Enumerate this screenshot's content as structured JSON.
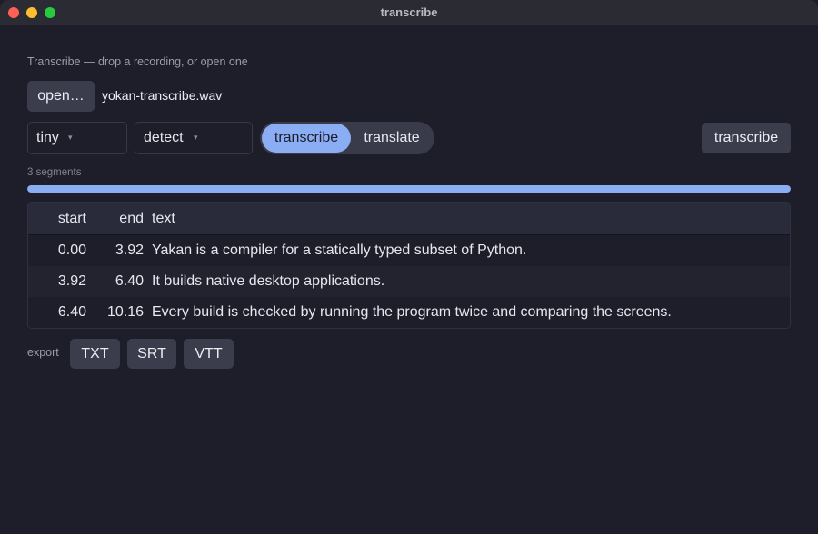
{
  "window": {
    "title": "transcribe"
  },
  "hint": "Transcribe — drop a recording, or open one",
  "file": {
    "open_label": "open…",
    "name": "yokan-transcribe.wav"
  },
  "options": {
    "model": "tiny",
    "language": "detect",
    "caret": "▾",
    "modes": [
      "transcribe",
      "translate"
    ],
    "selected_mode": "transcribe",
    "run_label": "transcribe"
  },
  "status": {
    "segments_label": "3 segments",
    "progress": 1.0
  },
  "table": {
    "headers": {
      "start": "start",
      "end": "end",
      "text": "text"
    },
    "rows": [
      {
        "start": "0.00",
        "end": "3.92",
        "text": "Yakan is a compiler for a statically typed subset of Python."
      },
      {
        "start": "3.92",
        "end": "6.40",
        "text": "It builds native desktop applications."
      },
      {
        "start": "6.40",
        "end": "10.16",
        "text": "Every build is checked by running the program twice and comparing the screens."
      }
    ]
  },
  "export": {
    "label": "export",
    "formats": [
      "TXT",
      "SRT",
      "VTT"
    ]
  },
  "colors": {
    "accent": "#8aadf4",
    "background": "#1e1e2a",
    "button": "#3c3d4c",
    "close": "#ff5f57",
    "minimize": "#febc2e",
    "maximize": "#28c840"
  }
}
